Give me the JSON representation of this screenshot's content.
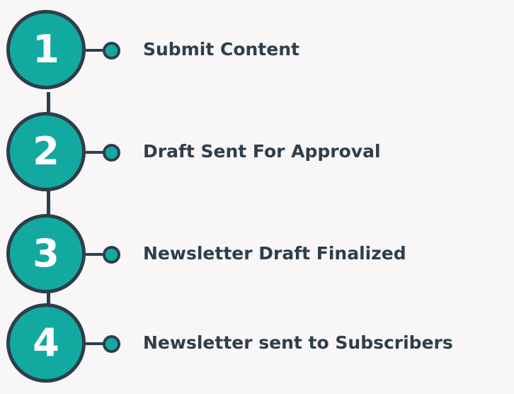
{
  "colors": {
    "background": "#f8f6f7",
    "accent": "#12aaa0",
    "outline": "#2f3e4a",
    "text": "#2f3e4a",
    "number_text": "#ffffff"
  },
  "steps": [
    {
      "number": "1",
      "label": "Submit Content"
    },
    {
      "number": "2",
      "label": "Draft Sent For Approval"
    },
    {
      "number": "3",
      "label": "Newsletter Draft Finalized"
    },
    {
      "number": "4",
      "label": "Newsletter sent to Subscribers"
    }
  ]
}
